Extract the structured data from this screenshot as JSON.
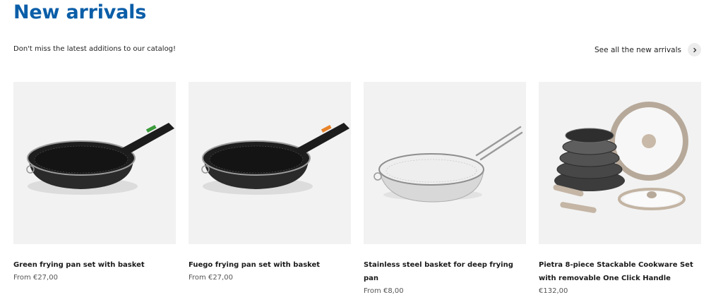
{
  "header": {
    "title": "New arrivals",
    "subtitle": "Don't miss the latest additions to our catalog!",
    "see_all_label": "See all the new arrivals",
    "see_all_icon": "chevron-right-icon"
  },
  "products": [
    {
      "title": "Green frying pan set with basket",
      "price": "From €27,00",
      "accent": "#3a9a3a"
    },
    {
      "title": "Fuego frying pan set with basket",
      "price": "From €27,00",
      "accent": "#e8832a"
    },
    {
      "title": "Stainless steel basket for deep frying pan",
      "price": "From €8,00"
    },
    {
      "title": "Pietra 8-piece Stackable Cookware Set with removable One Click Handle",
      "price": "€132,00"
    }
  ],
  "colors": {
    "brand": "#0b5ea8",
    "image_bg": "#f2f2f2"
  }
}
